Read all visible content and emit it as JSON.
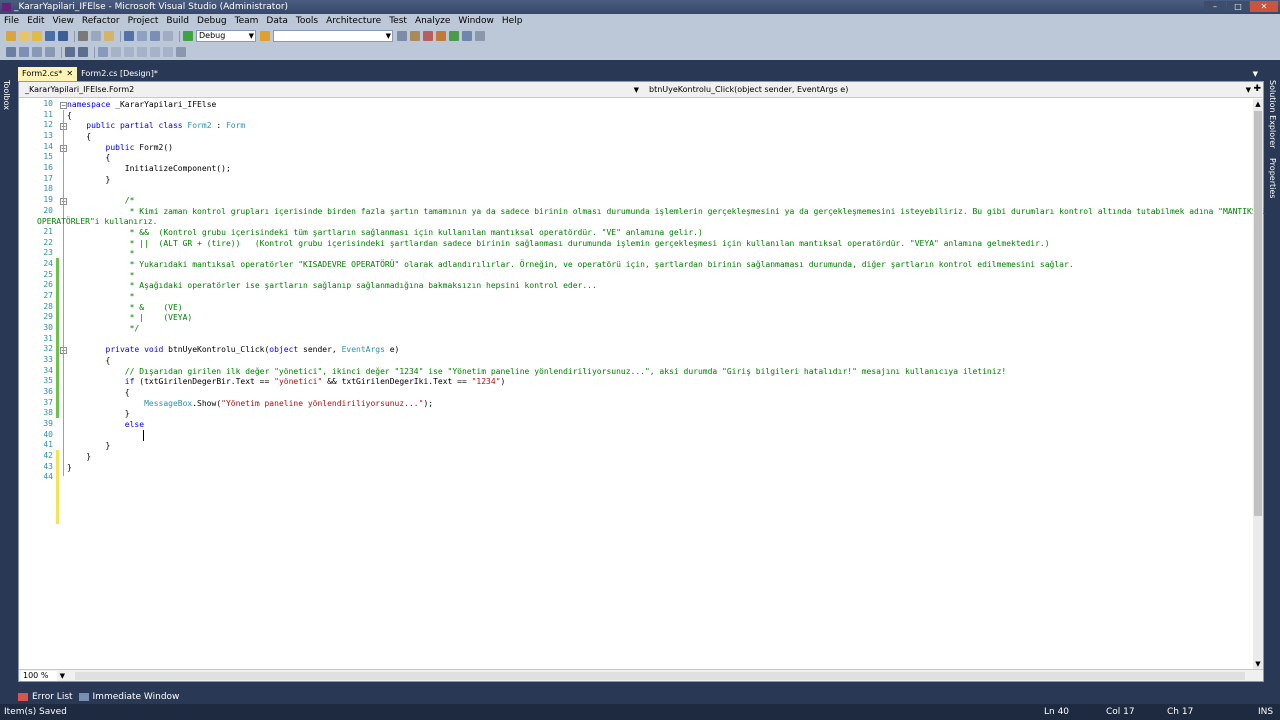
{
  "window": {
    "title": "_KararYapilari_IFElse - Microsoft Visual Studio (Administrator)",
    "minimize": "–",
    "maximize": "□",
    "close": "✕"
  },
  "menu": [
    "File",
    "Edit",
    "View",
    "Refactor",
    "Project",
    "Build",
    "Debug",
    "Team",
    "Data",
    "Tools",
    "Architecture",
    "Test",
    "Analyze",
    "Window",
    "Help"
  ],
  "toolbar": {
    "config_value": "Debug",
    "platform_value": ""
  },
  "side_left": {
    "toolbox_label": "Toolbox"
  },
  "side_right": {
    "solution_label": "Solution Explorer",
    "properties_label": "Properties"
  },
  "tabs": [
    {
      "label": "Form2.cs*",
      "close": "✕"
    },
    {
      "label": "Form2.cs [Design]*",
      "close": ""
    }
  ],
  "navbar": {
    "type_combo": "_KararYapilari_IFElse.Form2",
    "member_combo": "btnUyeKontrolu_Click(object sender, EventArgs e)"
  },
  "code": {
    "lines": [
      {
        "n": "10",
        "text": "namespace _KararYapilari_IFElse"
      },
      {
        "n": "11",
        "text": "{"
      },
      {
        "n": "12",
        "text": "    public partial class Form2 : Form"
      },
      {
        "n": "13",
        "text": "    {"
      },
      {
        "n": "14",
        "text": "        public Form2()"
      },
      {
        "n": "15",
        "text": "        {"
      },
      {
        "n": "16",
        "text": "            InitializeComponent();"
      },
      {
        "n": "17",
        "text": "        }"
      },
      {
        "n": "18",
        "text": ""
      },
      {
        "n": "19",
        "text": "            /*"
      },
      {
        "n": "20",
        "text": "             * Kimi zaman kontrol grupları içerisinde birden fazla şartın tamamının ya da sadece birinin olması durumunda işlemlerin gerçekleşmesini ya da gerçekleşmemesini isteyebiliriz. Bu gibi durumları kontrol altında tutabilmek adına \"MANTIKSAL"
      },
      {
        "n": "",
        "text": "OPERATÖRLER\"i kullanırız."
      },
      {
        "n": "21",
        "text": "             * &&  (Kontrol grubu içerisindeki tüm şartların sağlanması için kullanılan mantıksal operatördür. \"VE\" anlamına gelir.)"
      },
      {
        "n": "22",
        "text": "             * ||  (ALT GR + (tire))   (Kontrol grubu içerisindeki şartlardan sadece birinin sağlanması durumunda işlemin gerçekleşmesi için kullanılan mantıksal operatördür. \"VEYA\" anlamına gelmektedir.)"
      },
      {
        "n": "23",
        "text": "             *"
      },
      {
        "n": "24",
        "text": "             * Yukarıdaki mantıksal operatörler \"KISADEVRE OPERATÖRÜ\" olarak adlandırılırlar. Örneğin, ve operatörü için, şartlardan birinin sağlanmaması durumunda, diğer şartların kontrol edilmemesini sağlar."
      },
      {
        "n": "25",
        "text": "             *"
      },
      {
        "n": "26",
        "text": "             * Aşağıdaki operatörler ise şartların sağlanıp sağlanmadığına bakmaksızın hepsini kontrol eder..."
      },
      {
        "n": "27",
        "text": "             *"
      },
      {
        "n": "28",
        "text": "             * &    (VE)"
      },
      {
        "n": "29",
        "text": "             * |    (VEYA)"
      },
      {
        "n": "30",
        "text": "             */"
      },
      {
        "n": "31",
        "text": ""
      },
      {
        "n": "32",
        "text": "        private void btnUyeKontrolu_Click(object sender, EventArgs e)"
      },
      {
        "n": "33",
        "text": "        {"
      },
      {
        "n": "34",
        "text": "            // Dışarıdan girilen ilk değer \"yönetici\", ikinci değer \"1234\" ise \"Yönetim paneline yönlendiriliyorsunuz...\", aksi durumda \"Giriş bilgileri hatalıdır!\" mesajını kullanıcıya iletiniz!"
      },
      {
        "n": "35",
        "text": "            if (txtGirilenDegerBir.Text == \"yönetici\" && txtGirilenDegerIki.Text == \"1234\")"
      },
      {
        "n": "36",
        "text": "            {"
      },
      {
        "n": "37",
        "text": "                MessageBox.Show(\"Yönetim paneline yönlendiriliyorsunuz...\");"
      },
      {
        "n": "38",
        "text": "            }"
      },
      {
        "n": "39",
        "text": "            else"
      },
      {
        "n": "40",
        "text": ""
      },
      {
        "n": "41",
        "text": "        }"
      },
      {
        "n": "42",
        "text": "    }"
      },
      {
        "n": "43",
        "text": "}"
      },
      {
        "n": "44",
        "text": ""
      }
    ]
  },
  "zoom": "100 %",
  "bottom_tabs": [
    "Error List",
    "Immediate Window"
  ],
  "status": {
    "message": "Item(s) Saved",
    "line": "Ln 40",
    "col": "Col 17",
    "ch": "Ch 17",
    "mode": "INS"
  },
  "colors": {
    "keyword": "#0000ff",
    "type": "#2b91af",
    "comment": "#008000",
    "string": "#a31515",
    "changed_saved": "#6cc24a",
    "changed_unsaved": "#f2e35a"
  }
}
